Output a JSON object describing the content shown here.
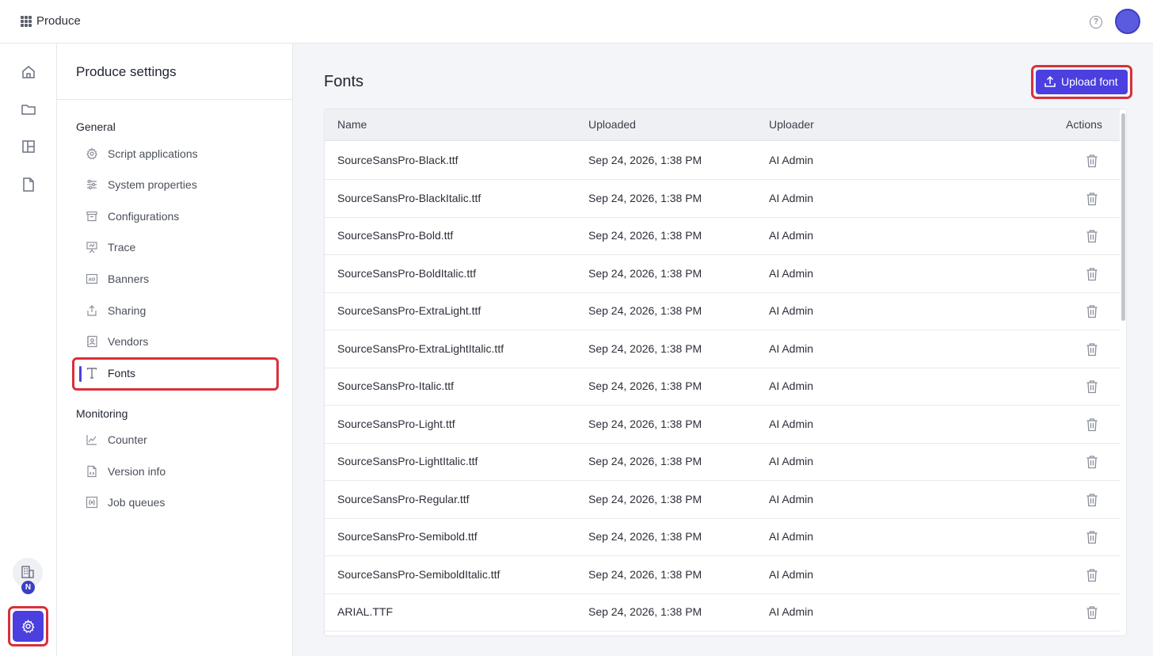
{
  "app": {
    "title": "Produce"
  },
  "header": {
    "help_icon": "question-circle-icon",
    "avatar": "user-avatar"
  },
  "rail": {
    "items": [
      "home-icon",
      "folder-icon",
      "layout-icon",
      "document-icon"
    ],
    "org_badge": "N",
    "settings_icon": "gear-icon"
  },
  "sidebar": {
    "title": "Produce settings",
    "groups": [
      {
        "label": "General",
        "items": [
          {
            "label": "Script applications",
            "icon": "gear-icon"
          },
          {
            "label": "System properties",
            "icon": "sliders-icon"
          },
          {
            "label": "Configurations",
            "icon": "archive-icon"
          },
          {
            "label": "Trace",
            "icon": "presentation-icon"
          },
          {
            "label": "Banners",
            "icon": "ad-icon"
          },
          {
            "label": "Sharing",
            "icon": "share-icon"
          },
          {
            "label": "Vendors",
            "icon": "contact-book-icon"
          },
          {
            "label": "Fonts",
            "icon": "typography-icon",
            "active": true
          }
        ]
      },
      {
        "label": "Monitoring",
        "items": [
          {
            "label": "Counter",
            "icon": "line-chart-icon"
          },
          {
            "label": "Version info",
            "icon": "code-file-icon"
          },
          {
            "label": "Job queues",
            "icon": "function-icon"
          }
        ]
      }
    ]
  },
  "main": {
    "title": "Fonts",
    "upload_button": "Upload font",
    "table": {
      "columns": [
        "Name",
        "Uploaded",
        "Uploader",
        "Actions"
      ],
      "rows": [
        {
          "name": "SourceSansPro-Black.ttf",
          "uploaded": "Sep 24, 2026, 1:38 PM",
          "uploader": "AI Admin"
        },
        {
          "name": "SourceSansPro-BlackItalic.ttf",
          "uploaded": "Sep 24, 2026, 1:38 PM",
          "uploader": "AI Admin"
        },
        {
          "name": "SourceSansPro-Bold.ttf",
          "uploaded": "Sep 24, 2026, 1:38 PM",
          "uploader": "AI Admin"
        },
        {
          "name": "SourceSansPro-BoldItalic.ttf",
          "uploaded": "Sep 24, 2026, 1:38 PM",
          "uploader": "AI Admin"
        },
        {
          "name": "SourceSansPro-ExtraLight.ttf",
          "uploaded": "Sep 24, 2026, 1:38 PM",
          "uploader": "AI Admin"
        },
        {
          "name": "SourceSansPro-ExtraLightItalic.ttf",
          "uploaded": "Sep 24, 2026, 1:38 PM",
          "uploader": "AI Admin"
        },
        {
          "name": "SourceSansPro-Italic.ttf",
          "uploaded": "Sep 24, 2026, 1:38 PM",
          "uploader": "AI Admin"
        },
        {
          "name": "SourceSansPro-Light.ttf",
          "uploaded": "Sep 24, 2026, 1:38 PM",
          "uploader": "AI Admin"
        },
        {
          "name": "SourceSansPro-LightItalic.ttf",
          "uploaded": "Sep 24, 2026, 1:38 PM",
          "uploader": "AI Admin"
        },
        {
          "name": "SourceSansPro-Regular.ttf",
          "uploaded": "Sep 24, 2026, 1:38 PM",
          "uploader": "AI Admin"
        },
        {
          "name": "SourceSansPro-Semibold.ttf",
          "uploaded": "Sep 24, 2026, 1:38 PM",
          "uploader": "AI Admin"
        },
        {
          "name": "SourceSansPro-SemiboldItalic.ttf",
          "uploaded": "Sep 24, 2026, 1:38 PM",
          "uploader": "AI Admin"
        },
        {
          "name": "ARIAL.TTF",
          "uploaded": "Sep 24, 2026, 1:38 PM",
          "uploader": "AI Admin"
        }
      ]
    }
  },
  "colors": {
    "accent": "#4b3fe0",
    "highlight": "#d9303a",
    "background": "#f4f5f8"
  }
}
